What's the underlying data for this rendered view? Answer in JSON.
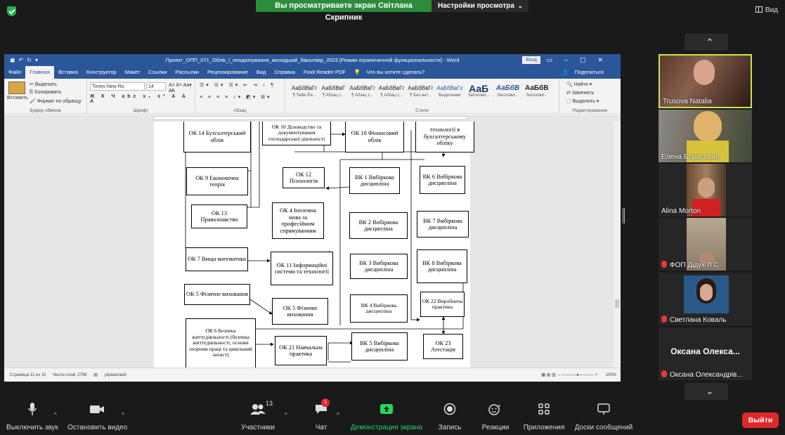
{
  "top": {
    "share_banner": "Вы просматриваете экран Світлана Скрипник",
    "view_options": "Настройки просмотра",
    "view_button": "Вид"
  },
  "word": {
    "title": "Проект_ОПП_071_Облік_і_оподаткування_молодший_бакалавр_2023 [Режим ограниченной функциональности] - Word",
    "login": "Вход",
    "tabs": [
      "Файл",
      "Главная",
      "Вставка",
      "Конструктор",
      "Макет",
      "Ссылки",
      "Рассылки",
      "Рецензирование",
      "Вид",
      "Справка",
      "Foxit Reader PDF",
      "Что вы хотите сделать?"
    ],
    "share": "Поделиться",
    "clipboard": {
      "paste": "Вставить",
      "cut": "Вырезать",
      "copy": "Копировать",
      "format": "Формат по образцу",
      "label": "Буфер обмена"
    },
    "font": {
      "name": "Times New Ro",
      "size": "14",
      "label": "Шрифт"
    },
    "paragraph_label": "Абзац",
    "styles_label": "Стили",
    "styles": [
      {
        "sample": "АаБбВвГг",
        "name": "¶ Table Pa..."
      },
      {
        "sample": "АаБбВвГ",
        "name": "¶ Абзац с..."
      },
      {
        "sample": "АаБбВвГг",
        "name": "¶ Абзац с..."
      },
      {
        "sample": "АаБбВвГг",
        "name": "¶ Абзац с..."
      },
      {
        "sample": "АаБбВвГг",
        "name": "¶ Без инт..."
      },
      {
        "sample": "АаБбВвГг",
        "name": "Выделение"
      },
      {
        "sample": "АаБ",
        "name": "Заголово..."
      },
      {
        "sample": "АаБбВ",
        "name": "Заголово..."
      },
      {
        "sample": "АаБбВ",
        "name": "Заголово..."
      }
    ],
    "editing": {
      "find": "Найти",
      "replace": "Заменить",
      "select": "Выделить",
      "label": "Редактирование"
    },
    "status": {
      "page": "Страница 11 из 15",
      "words": "Число слов: 2796",
      "lang": "украинский",
      "zoom": "100%"
    }
  },
  "diagram": {
    "ok14": "ОК 14 Бухгалтерський облік",
    "ok10": "ОК 10 Діловодство та документування господарської діяльності",
    "ok18": "ОК 18 Фінансовий облік",
    "it_acc": "технології в бухгалтерському обліку",
    "ok9": "ОК 9 Економічна теорія",
    "ok12": "ОК 12 Психологія",
    "vk1": "ВК 1 Вибіркова дисципліна",
    "vk6": "ВК 6 Вибіркова дисципліна",
    "ok13": "ОК 13 Правознавство",
    "ok4": "ОК 4 Іноземна мова за професійним спрямуванням",
    "vk2": "ВК 2 Вибіркова дисципліна",
    "vk7": "ВК 7 Вибіркова дисципліна",
    "ok7": "ОК 7 Вища математика",
    "ok11": "ОК 11 Інформаційні системи та технології",
    "vk3": "ВК 3 Вибіркова дисципліна",
    "vk8": "ВК 8 Вибіркова дисципліна",
    "ok5a": "ОК 5 Фізичне виховання",
    "ok5b": "ОК 5 Фізичне виховання",
    "vk4": "ВК 4 Вибіркова дисципліна",
    "ok22": "ОК 22 Виробнича практика",
    "ok6": "ОК 6 Безпека життєдіяльності (безпека життєдіяльності, основи охорони праці та цивільний захист)",
    "ok21": "ОК 21 Навчальна практика",
    "vk5": "ВК 5 Вибіркова дисципліна",
    "ok23": "ОК 23 Атестація"
  },
  "participants": [
    {
      "name": "Trusova Natalia",
      "muted": false
    },
    {
      "name": "Елена Борисовна",
      "muted": false
    },
    {
      "name": "Alina Morton",
      "muted": false
    },
    {
      "name": "ФОП Дідух Л С",
      "muted": true
    },
    {
      "name": "Светлана Коваль",
      "muted": true
    },
    {
      "name": "Оксана Олександрів...",
      "muted": true,
      "display": "Оксана Олекса..."
    }
  ],
  "toolbar": {
    "mute": "Выключить звук",
    "video": "Остановить видео",
    "participants": "Участники",
    "participants_count": "13",
    "chat": "Чат",
    "chat_badge": "1",
    "share": "Демонстрация экрана",
    "record": "Запись",
    "reactions": "Реакции",
    "apps": "Приложения",
    "whiteboard": "Доски сообщений",
    "leave": "Выйти"
  },
  "colors": {
    "word_blue": "#2b579a",
    "share_green": "#2d8c3c",
    "accent_green": "#23d959",
    "leave_red": "#e02828",
    "active_border": "#c8e64b"
  }
}
